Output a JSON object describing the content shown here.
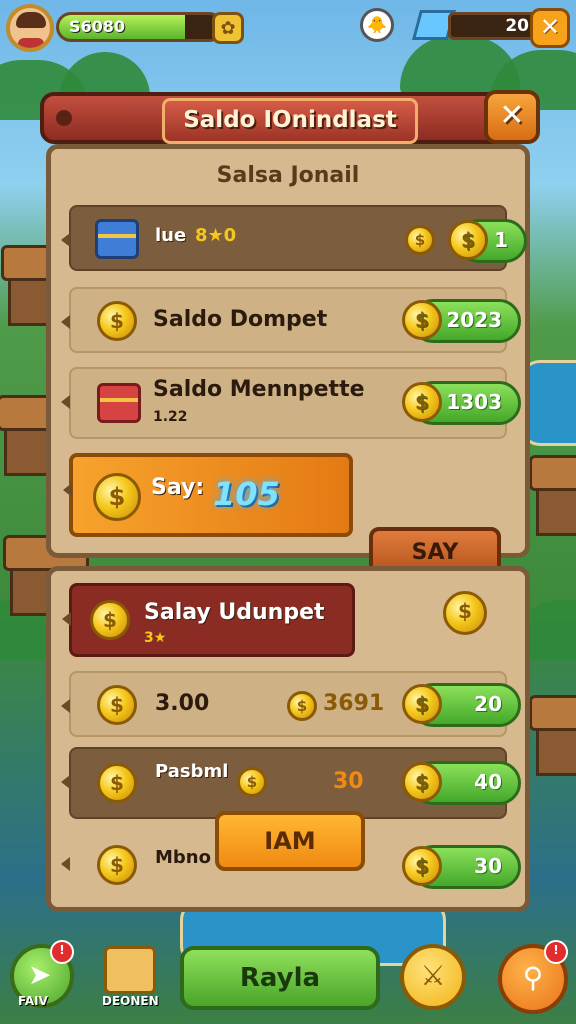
{
  "hud": {
    "xp_text": "S6080",
    "xp_fill_fraction": 0.78,
    "gem_count": "20",
    "icons": {
      "settings": "gear-icon",
      "pet": "chick-icon",
      "gem": "gem-icon",
      "close": "close-icon"
    }
  },
  "dialog": {
    "title": "Saldo IOnindlast",
    "close_glyph": "✕",
    "subtitle": "Salsa Jonail"
  },
  "section1": {
    "rows": [
      {
        "label": "lue",
        "sub": "8★0",
        "value": "1",
        "icon": "blue-chest-icon"
      },
      {
        "label": "Saldo Dompet",
        "value": "2023",
        "icon": "coin-icon"
      },
      {
        "label": "Saldo Mennpette",
        "sub": "1.22",
        "value": "1303",
        "icon": "red-chest-icon"
      },
      {
        "label": "Say:",
        "highlight": "105",
        "button": "SAY",
        "icon": "coin-icon"
      }
    ]
  },
  "section2": {
    "rows": [
      {
        "label": "Salay Udunpet",
        "sub": "3★",
        "icon": "coin-icon"
      },
      {
        "label": "3.00",
        "mid": "3691",
        "value": "20",
        "icon": "coin-icon"
      },
      {
        "label": "Pasbml",
        "mid": "30",
        "value": "40",
        "icon": "coin-icon"
      },
      {
        "label": "Mbno",
        "button": "IAM",
        "value": "30",
        "icon": "coin-icon"
      }
    ]
  },
  "bottom": {
    "left_label": "FAIV",
    "left_badge": "!",
    "box_label": "DEONEN",
    "main_label": "Rayla",
    "right_badge": "!"
  },
  "colors": {
    "panel": "#d7b98f",
    "header_red": "#c24f3e",
    "accent_green": "#5ab52a",
    "accent_orange": "#f08a12",
    "coin_gold": "#f5c71a"
  }
}
